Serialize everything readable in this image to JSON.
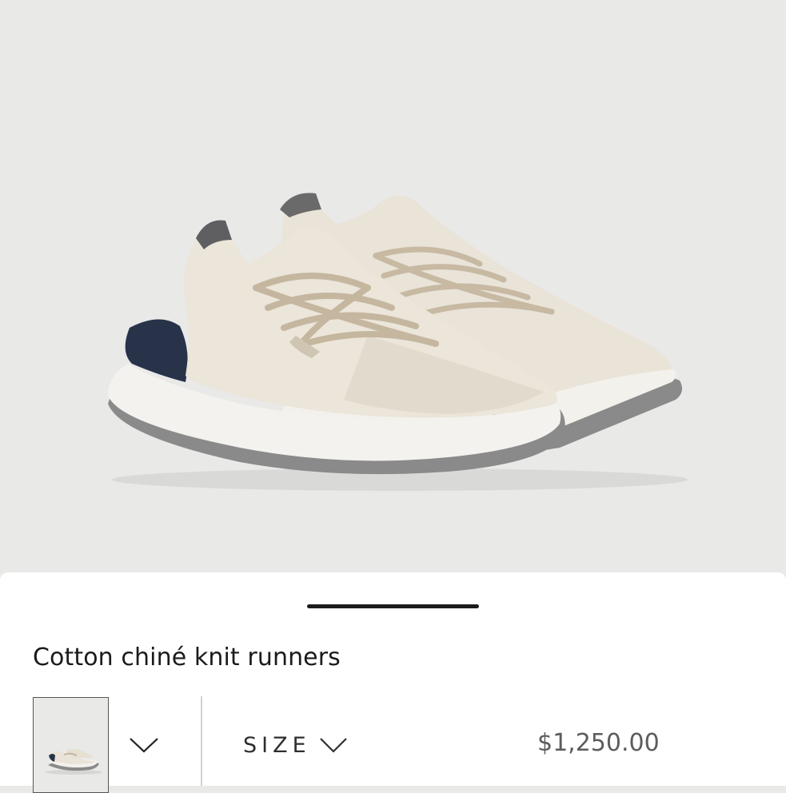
{
  "product": {
    "title": "Cotton chiné knit runners",
    "price": "$1,250.00",
    "size_label": "SIZE",
    "image_subject": "beige knit running sneakers with taupe laces, white sole, navy heel counter and grey tread"
  },
  "icons": {
    "color_selector": "chevron-down-icon",
    "size_selector": "chevron-down-icon"
  },
  "colors": {
    "hero_background": "#e9e9e8",
    "sheet_background": "#ffffff",
    "text_primary": "#1b1b1b",
    "price_text": "#5c5c5c",
    "shoe_knit": "#e7e0d3",
    "shoe_laces": "#c7b9a2",
    "sole": "#f4f2ee",
    "heel_navy": "#28334a",
    "tread_grey": "#858585"
  }
}
